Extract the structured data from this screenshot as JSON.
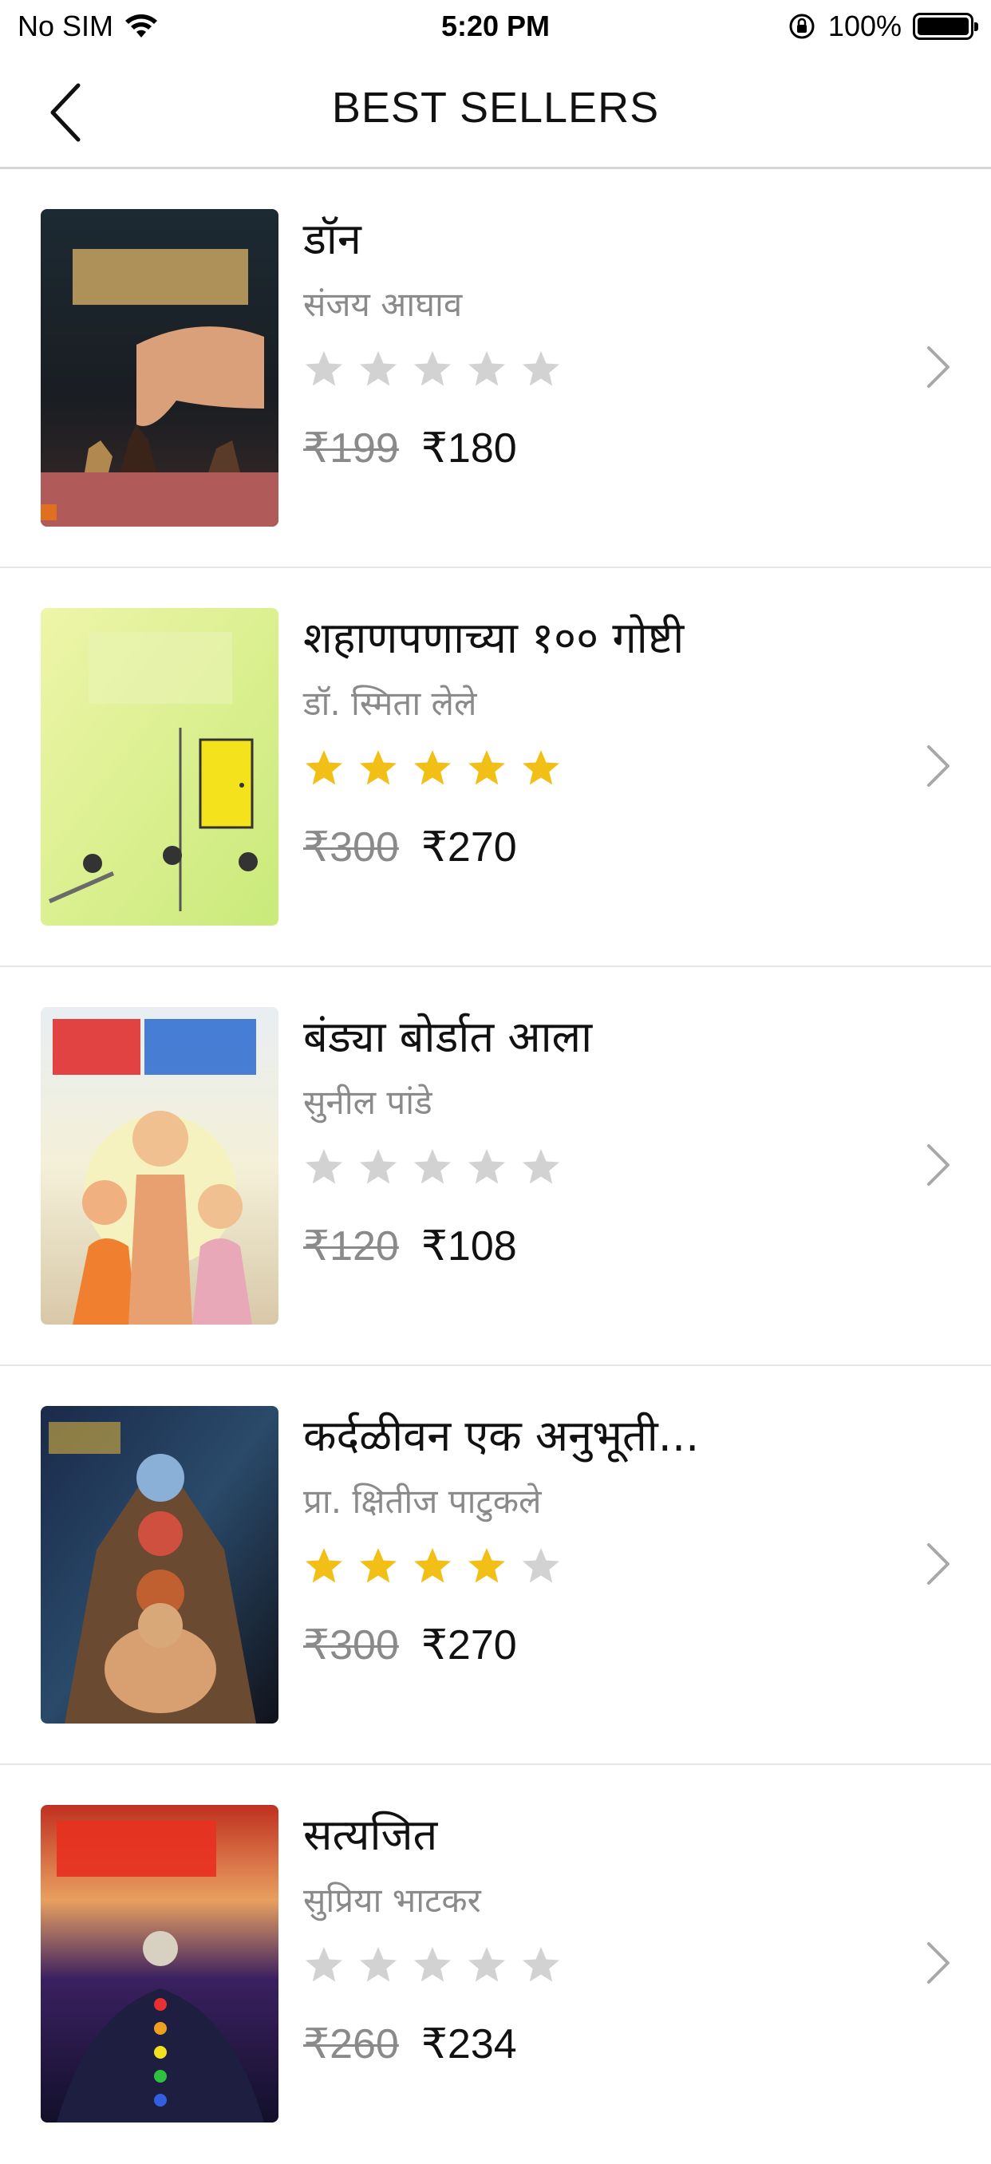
{
  "status_bar": {
    "carrier": "No SIM",
    "time": "5:20 PM",
    "battery": "100%"
  },
  "nav": {
    "title": "BEST SELLERS",
    "back_icon": "chevron-left-icon"
  },
  "books": [
    {
      "title": "डॉन",
      "author": "संजय आघाव",
      "rating": 0,
      "mrp": "₹199",
      "price": "₹180"
    },
    {
      "title": "शहाणपणाच्या १०० गोष्टी",
      "author": "डॉ. स्मिता लेले",
      "rating": 5,
      "mrp": "₹300",
      "price": "₹270"
    },
    {
      "title": "बंड्या बोर्डात आला",
      "author": "सुनील पांडे",
      "rating": 0,
      "mrp": "₹120",
      "price": "₹108"
    },
    {
      "title": "कर्दळीवन एक अनुभूती...",
      "author": "प्रा. क्षितीज पाटुकले",
      "rating": 4,
      "mrp": "₹300",
      "price": "₹270"
    },
    {
      "title": "सत्यजित",
      "author": "सुप्रिया भाटकर",
      "rating": 0,
      "mrp": "₹260",
      "price": "₹234"
    }
  ],
  "colors": {
    "star_filled": "#f2bf16",
    "star_empty": "#d2d2d2",
    "author_text": "#8a8a8a"
  }
}
